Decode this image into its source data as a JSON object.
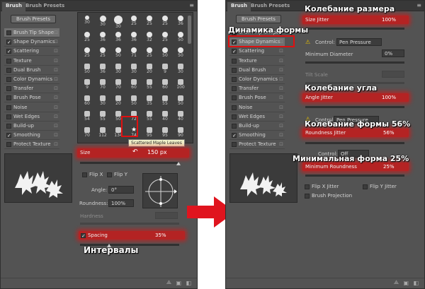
{
  "left": {
    "tabs": [
      "Brush",
      "Brush Presets"
    ],
    "presets_button": "Brush Presets",
    "options": [
      {
        "label": "Brush Tip Shape",
        "checked": false,
        "selected": true
      },
      {
        "label": "Shape Dynamics",
        "checked": true
      },
      {
        "label": "Scattering",
        "checked": true
      },
      {
        "label": "Texture",
        "checked": false
      },
      {
        "label": "Dual Brush",
        "checked": false
      },
      {
        "label": "Color Dynamics",
        "checked": false
      },
      {
        "label": "Transfer",
        "checked": false
      },
      {
        "label": "Brush Pose",
        "checked": false
      },
      {
        "label": "Noise",
        "checked": false
      },
      {
        "label": "Wet Edges",
        "checked": false
      },
      {
        "label": "Build-up",
        "checked": false
      },
      {
        "label": "Smoothing",
        "checked": true
      },
      {
        "label": "Protect Texture",
        "checked": false
      }
    ],
    "brush_numbers": [
      [
        "30",
        "30",
        "30",
        "25",
        "25",
        "25",
        "36"
      ],
      [
        "25",
        "36",
        "36",
        "36",
        "32",
        "25",
        "50"
      ],
      [
        "25",
        "25",
        "50",
        "71",
        "25",
        "50",
        "50"
      ],
      [
        "50",
        "36",
        "30",
        "30",
        "20",
        "9",
        "30"
      ],
      [
        "9",
        "70",
        "70",
        "60",
        "55",
        "60",
        "100"
      ],
      [
        "60",
        "30",
        "20",
        "50",
        "35",
        "55",
        "50"
      ],
      [
        "54",
        "55",
        "50",
        "72",
        "55",
        "40",
        "40"
      ],
      [
        "70",
        "112",
        "134",
        "74",
        "95",
        "95",
        "90"
      ]
    ],
    "tooltip": "Scattered Maple Leaves",
    "size_label": "Size",
    "size_value": "150 px",
    "flip_x": "Flip X",
    "flip_y": "Flip Y",
    "angle_label": "Angle:",
    "angle_value": "0°",
    "roundness_label": "Roundness:",
    "roundness_value": "100%",
    "hardness_label": "Hardness",
    "spacing_label": "Spacing",
    "spacing_value": "35%",
    "spacing_check": "✓"
  },
  "right": {
    "tabs": [
      "Brush",
      "Brush Presets"
    ],
    "presets_button": "Brush Presets",
    "options": [
      {
        "label": "Brush Tip Shape",
        "checked": false
      },
      {
        "label": "Shape Dynamics",
        "checked": true,
        "selected": true
      },
      {
        "label": "Scattering",
        "checked": true
      },
      {
        "label": "Texture",
        "checked": false
      },
      {
        "label": "Dual Brush",
        "checked": false
      },
      {
        "label": "Color Dynamics",
        "checked": false
      },
      {
        "label": "Transfer",
        "checked": false
      },
      {
        "label": "Brush Pose",
        "checked": false
      },
      {
        "label": "Noise",
        "checked": false
      },
      {
        "label": "Wet Edges",
        "checked": false
      },
      {
        "label": "Build-up",
        "checked": false
      },
      {
        "label": "Smoothing",
        "checked": true
      },
      {
        "label": "Protect Texture",
        "checked": false
      }
    ],
    "size_jitter_label": "Size Jitter",
    "size_jitter_value": "100%",
    "control_label": "Control:",
    "control_value_1": "Pen Pressure",
    "min_diameter_label": "Minimum Diameter",
    "min_diameter_value": "0%",
    "tilt_scale_label": "Tilt Scale",
    "angle_jitter_label": "Angle Jitter",
    "angle_jitter_value": "100%",
    "control_value_2": "Pen Pressure",
    "roundness_jitter_label": "Roundness Jitter",
    "roundness_jitter_value": "56%",
    "control_value_3": "Off",
    "min_roundness_label": "Minimum Roundness",
    "min_roundness_value": "25%",
    "flip_x_jitter": "Flip X Jitter",
    "flip_y_jitter": "Flip Y Jitter",
    "brush_projection": "Brush Projection"
  },
  "annotations": {
    "intervals": "Интервалы",
    "shape_dynamics": "Динамика формы",
    "size_jitter": "Колебание размера",
    "angle_jitter": "Колебание угла",
    "roundness_jitter": "Колебание формы 56%",
    "min_roundness": "Минимальная форма 25%"
  },
  "colors": {
    "panel_bg": "#535353",
    "highlight_red": "#d51414",
    "arrow_red": "#e0141e"
  }
}
